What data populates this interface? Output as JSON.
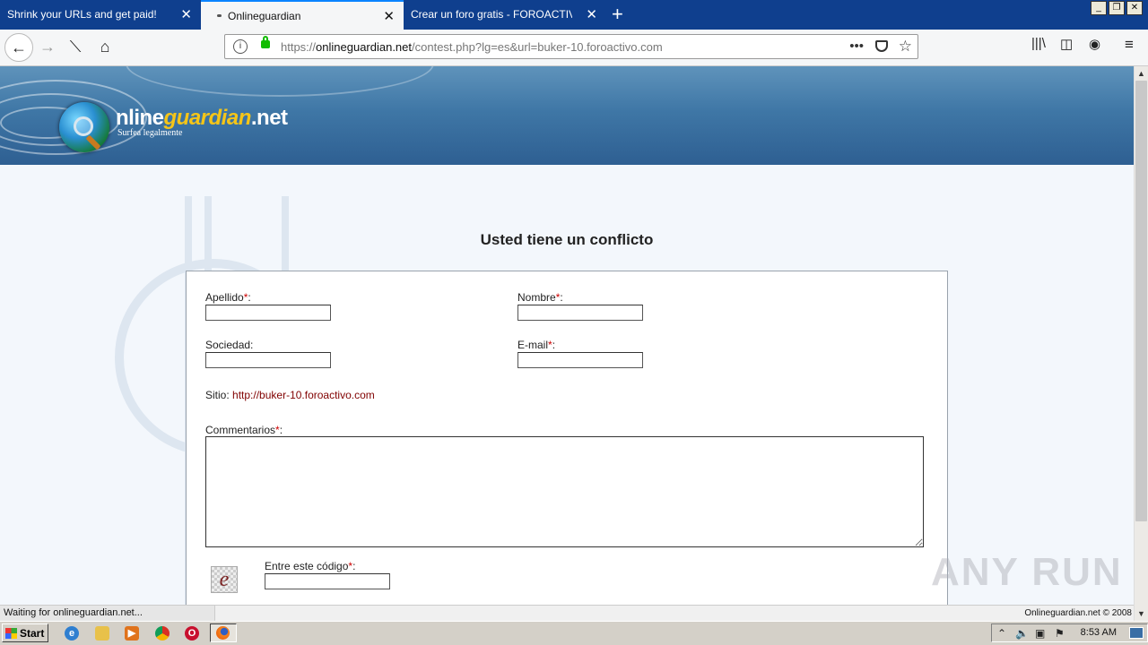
{
  "browser": {
    "tabs": [
      {
        "label": "Shrink your URLs and get paid!",
        "active": false
      },
      {
        "label": "Onlineguardian",
        "active": true
      },
      {
        "label": "Crear un foro gratis - FOROACTIVO.COM",
        "active": false
      }
    ],
    "url_prefix": "https://",
    "url_domain": "onlineguardian.net",
    "url_path": "/contest.php?lg=es&url=buker-10.foroactivo.com",
    "more_glyph": "•••",
    "close_glyph": "✕",
    "new_tab_glyph": "+"
  },
  "site": {
    "logo_prefix": "nline",
    "logo_highlight": "guardian",
    "logo_suffix": ".net",
    "tagline": "Surfea legalmente"
  },
  "form": {
    "title": "Usted tiene un conflicto",
    "required_mark": "*",
    "colon": ":",
    "apellido_label": "Apellido",
    "nombre_label": "Nombre",
    "sociedad_label": "Sociedad:",
    "email_label": "E-mail",
    "sitio_label": "Sitio:",
    "sitio_url": "http://buker-10.foroactivo.com",
    "comments_label": "Commentarios",
    "captcha_label": "Entre este código",
    "captcha_char": "e"
  },
  "status": {
    "text": "Waiting for onlineguardian.net...",
    "footer": "Onlineguardian.net © 2008"
  },
  "taskbar": {
    "start_label": "Start",
    "clock": "8:53 AM"
  },
  "watermark": "ANY RUN",
  "colors": {
    "tabbar": "#0f3f8e",
    "accent": "#0a84ff",
    "required": "#cc0000",
    "link": "#800000",
    "logo_highlight": "#f5c518"
  }
}
